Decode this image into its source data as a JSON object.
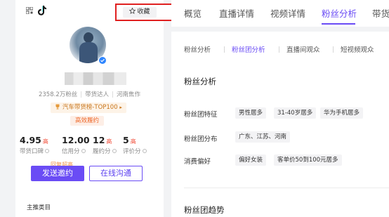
{
  "profile": {
    "collect_label": "收藏",
    "stats": {
      "fans": "2358.2万粉丝",
      "role": "带货达人",
      "location": "河南焦作"
    },
    "rank_badge": "汽车带货榜-TOP100",
    "efficient_tag": "高效履约",
    "metrics": [
      {
        "value": "4.95",
        "level": "高",
        "label": "带货口碑"
      },
      {
        "value": "12.00",
        "level": "",
        "label": "信用分"
      },
      {
        "value": "12",
        "level": "高",
        "label": "履约分"
      },
      {
        "value": "5",
        "level": "高",
        "label": "评价分"
      }
    ],
    "reply_tag": "回复超高",
    "send_invite": "发送邀约",
    "online_chat": "在线沟通",
    "main_category": "主推类目"
  },
  "tabs": [
    "概览",
    "直播详情",
    "视频详情",
    "粉丝分析",
    "带货"
  ],
  "subtabs": [
    "粉丝分析",
    "粉丝团分析",
    "直播间观众",
    "短视频观众"
  ],
  "fan_analysis": {
    "title": "粉丝分析",
    "rows": [
      {
        "label": "粉丝团特征",
        "chips": [
          "男性居多",
          "31-40岁居多",
          "华为手机居多"
        ]
      },
      {
        "label": "粉丝团分布",
        "chips": [
          "广东、江苏、河南"
        ]
      },
      {
        "label": "消费偏好",
        "chips": [
          "偏好女装",
          "客单价50到100元居多"
        ]
      }
    ]
  },
  "trend_title": "粉丝团趋势",
  "colors": {
    "accent": "#6a4cf5",
    "highlight_border": "#e02020",
    "level_red": "#f04a35"
  }
}
